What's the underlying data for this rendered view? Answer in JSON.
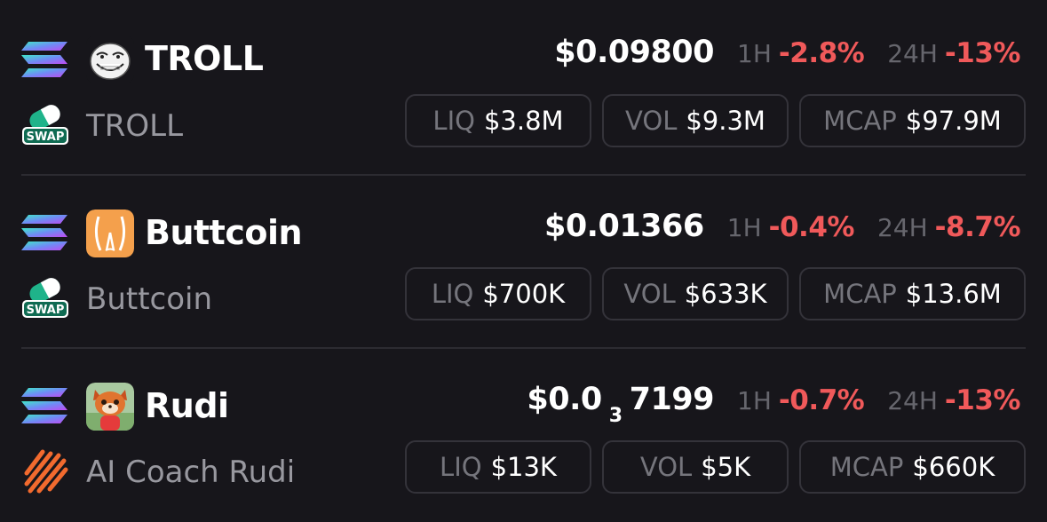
{
  "tokens": [
    {
      "symbol": "TROLL",
      "name": "TROLL",
      "chain_icon": "solana-icon",
      "avatar_icon": "troll-face-avatar",
      "dex_icon": "swap-pill-icon",
      "dex_label": "SWAP",
      "price": "$0.09800",
      "change_1h_label": "1H",
      "change_1h": "-2.8%",
      "change_24h_label": "24H",
      "change_24h": "-13%",
      "liq_label": "LIQ",
      "liq": "$3.8M",
      "vol_label": "VOL",
      "vol": "$9.3M",
      "mcap_label": "MCAP",
      "mcap": "$97.9M"
    },
    {
      "symbol": "Buttcoin",
      "name": "Buttcoin",
      "chain_icon": "solana-icon",
      "avatar_icon": "buttcoin-avatar",
      "dex_icon": "swap-pill-icon",
      "dex_label": "SWAP",
      "price": "$0.01366",
      "change_1h_label": "1H",
      "change_1h": "-0.4%",
      "change_24h_label": "24H",
      "change_24h": "-8.7%",
      "liq_label": "LIQ",
      "liq": "$700K",
      "vol_label": "VOL",
      "vol": "$633K",
      "mcap_label": "MCAP",
      "mcap": "$13.6M"
    },
    {
      "symbol": "Rudi",
      "name": "AI Coach Rudi",
      "chain_icon": "solana-icon",
      "avatar_icon": "red-panda-avatar",
      "dex_icon": "orange-stripes-icon",
      "price_prefix": "$0.0",
      "price_zero_count": "3",
      "price_suffix": "7199",
      "change_1h_label": "1H",
      "change_1h": "-0.7%",
      "change_24h_label": "24H",
      "change_24h": "-13%",
      "liq_label": "LIQ",
      "liq": "$13K",
      "vol_label": "VOL",
      "vol": "$5K",
      "mcap_label": "MCAP",
      "mcap": "$660K"
    }
  ],
  "colors": {
    "background": "#17161b",
    "negative": "#f0595a",
    "muted_label": "#66666d",
    "pill_border": "#34333a"
  }
}
